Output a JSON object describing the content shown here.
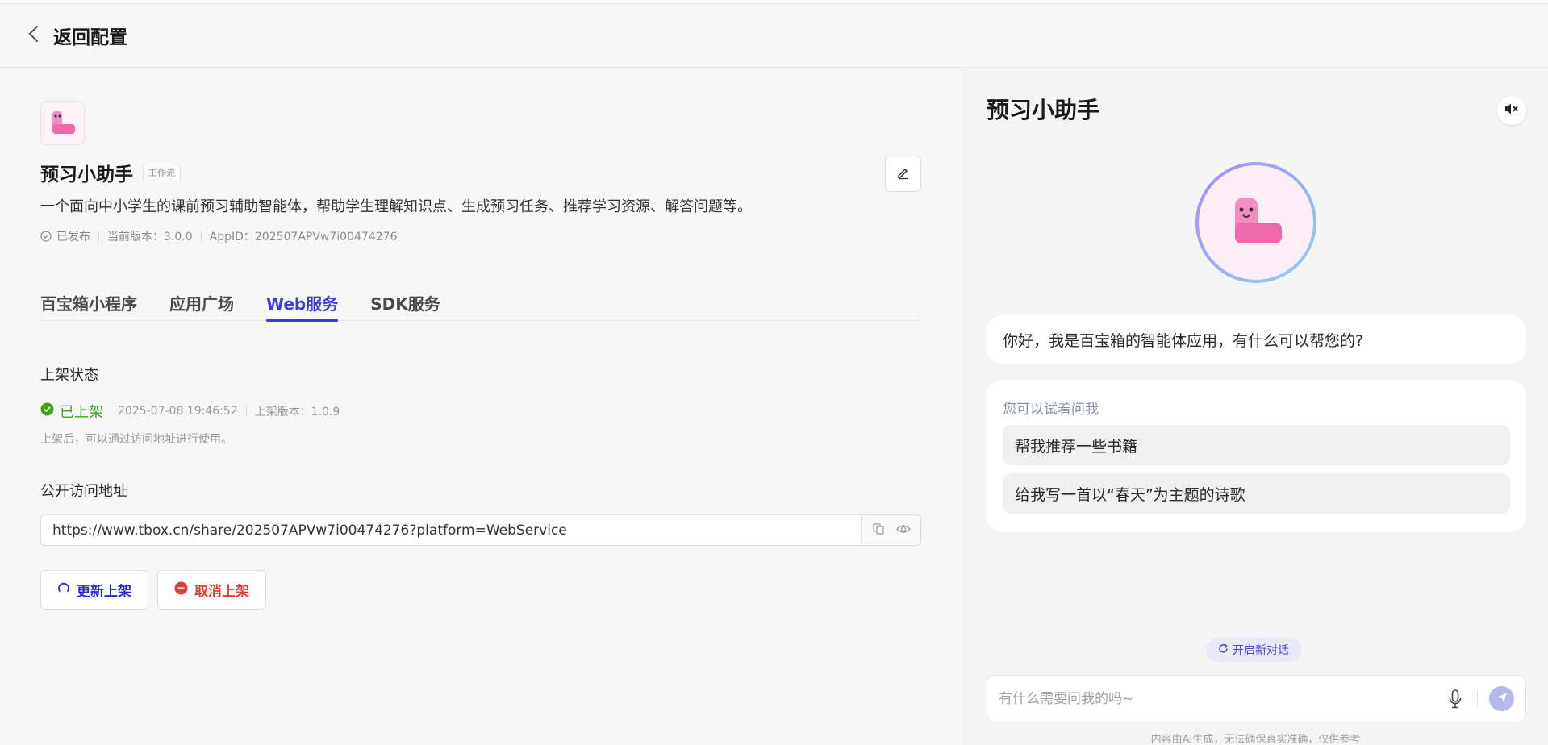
{
  "header": {
    "back_label": "返回配置"
  },
  "app": {
    "name": "预习小助手",
    "tag": "工作流",
    "description": "一个面向中小学生的课前预习辅助智能体，帮助学生理解知识点、生成预习任务、推荐学习资源、解答问题等。",
    "published": "已发布",
    "version": "当前版本：3.0.0",
    "app_id": "AppID：202507APVw7i00474276"
  },
  "tabs": [
    {
      "label": "百宝箱小程序"
    },
    {
      "label": "应用广场"
    },
    {
      "label": "Web服务"
    },
    {
      "label": "SDK服务"
    }
  ],
  "active_tab": "Web服务",
  "listing": {
    "section_title": "上架状态",
    "status": "已上架",
    "timestamp": "2025-07-08 19:46:52",
    "listed_version": "上架版本：1.0.9",
    "hint": "上架后，可以通过访问地址进行使用。"
  },
  "url_section": {
    "title": "公开访问地址",
    "url": "https://www.tbox.cn/share/202507APVw7i00474276?platform=WebService"
  },
  "buttons": {
    "update": "更新上架",
    "cancel": "取消上架"
  },
  "chat": {
    "title": "预习小助手",
    "greeting": "你好，我是百宝箱的智能体应用，有什么可以帮您的?",
    "suggest_title": "您可以试着问我",
    "suggestions": [
      "帮我推荐一些书籍",
      "给我写一首以“春天”为主题的诗歌"
    ],
    "new_chat": "开启新对话",
    "input_placeholder": "有什么需要问我的吗~",
    "disclaimer": "内容由AI生成，无法确保真实准确，仅供参考"
  },
  "colors": {
    "accent": "#3c3cd6",
    "success": "#3aa515",
    "danger": "#e23d3d"
  }
}
